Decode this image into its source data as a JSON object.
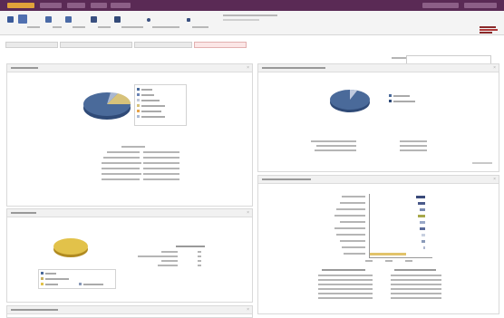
{
  "menu": {
    "items": [
      "",
      "",
      "",
      "",
      ""
    ]
  },
  "toolbar": {
    "buttons": [
      "",
      "",
      "",
      "",
      "",
      "",
      "",
      ""
    ]
  },
  "breadcrumb": {
    "items": [
      "",
      "",
      "",
      ""
    ]
  },
  "search": {
    "placeholder": ""
  },
  "panels": {
    "top_left": {
      "title": ""
    },
    "mid_left": {
      "title": ""
    },
    "bottom_left": {
      "title": ""
    },
    "top_right": {
      "title": ""
    },
    "bottom_right": {
      "title": ""
    }
  },
  "colors": {
    "menu": "#5a2a55",
    "active": "#e0a23a",
    "pie_blue": "#4a6a9a",
    "pie_gold": "#d9b43a",
    "bar_navy": "#3a4a7a",
    "bar_gold": "#e2c36a"
  },
  "icons": [
    "home-icon",
    "save-icon",
    "print-icon",
    "folder-icon",
    "user-icon",
    "settings-icon",
    "logo-icon"
  ]
}
